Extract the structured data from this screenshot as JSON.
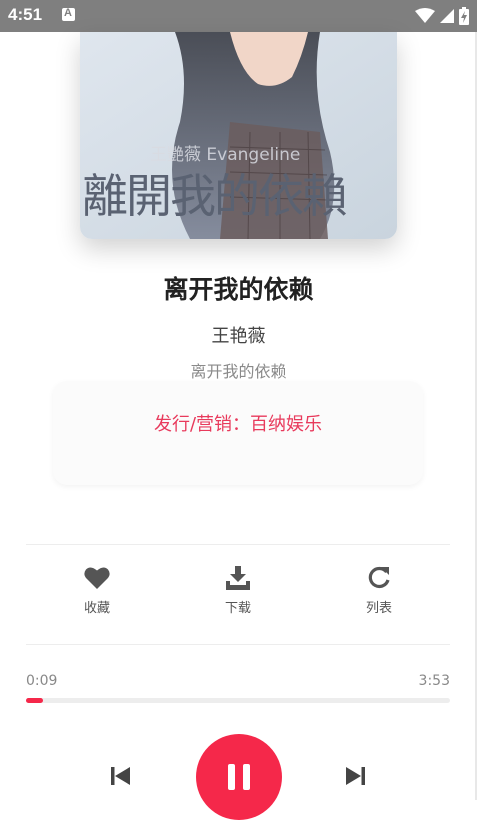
{
  "status_bar": {
    "time": "4:51"
  },
  "cover": {
    "overlay_artist": "王艷薇 Evangeline",
    "overlay_title": "離開我的依賴"
  },
  "song": {
    "title": "离开我的依赖",
    "artist": "王艳薇",
    "album": "离开我的依赖"
  },
  "info_card": {
    "text": "发行/营销：百纳娱乐"
  },
  "actions": [
    {
      "label": "收藏",
      "icon": "heart-icon"
    },
    {
      "label": "下载",
      "icon": "download-icon"
    },
    {
      "label": "列表",
      "icon": "refresh-icon"
    }
  ],
  "player": {
    "current_time": "0:09",
    "total_time": "3:53",
    "progress_fraction": 0.039,
    "accent_color": "#f5284a"
  }
}
